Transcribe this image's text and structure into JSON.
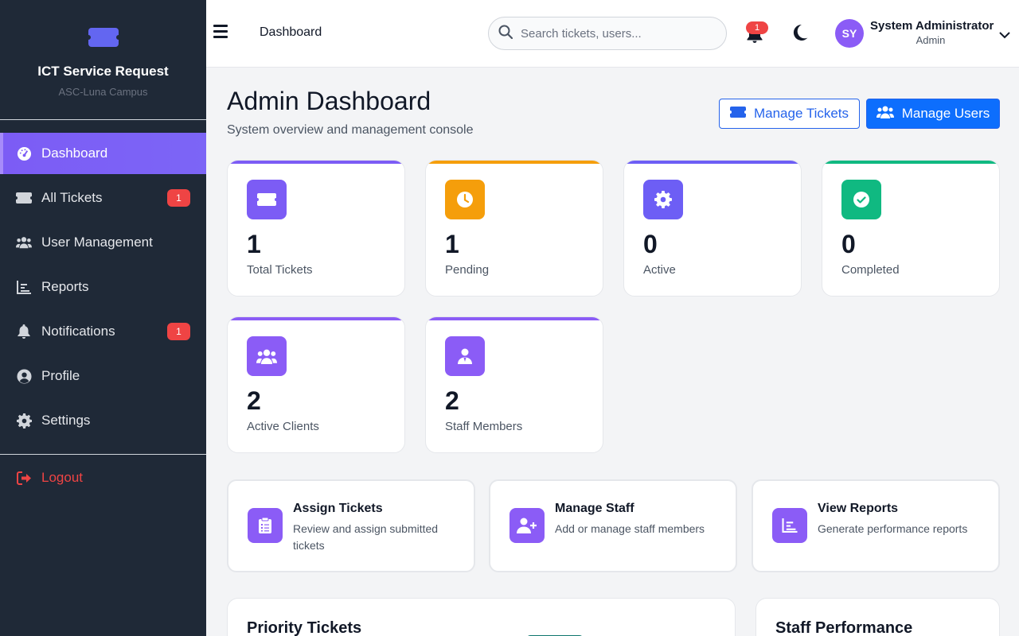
{
  "sidebar": {
    "brand_title": "ICT Service Request",
    "brand_subtitle": "ASC-Luna Campus",
    "items": [
      {
        "label": "Dashboard",
        "icon": "gauge-icon",
        "active": true
      },
      {
        "label": "All Tickets",
        "icon": "ticket-icon",
        "badge": "1"
      },
      {
        "label": "User Management",
        "icon": "users-icon"
      },
      {
        "label": "Reports",
        "icon": "chart-icon"
      },
      {
        "label": "Notifications",
        "icon": "bell-icon",
        "badge": "1"
      },
      {
        "label": "Profile",
        "icon": "user-circle-icon"
      },
      {
        "label": "Settings",
        "icon": "gear-icon"
      }
    ],
    "logout_label": "Logout"
  },
  "topbar": {
    "breadcrumb": "Dashboard",
    "search_placeholder": "Search tickets, users...",
    "notification_count": "1",
    "user": {
      "initials": "SY",
      "name": "System Administrator",
      "role": "Admin"
    }
  },
  "main": {
    "title": "Admin Dashboard",
    "subtitle": "System overview and management console",
    "manage_tickets_label": "Manage Tickets",
    "manage_users_label": "Manage Users",
    "stats": [
      {
        "value": "1",
        "label": "Total Tickets",
        "color": "#7c5cf5",
        "icon": "ticket-icon"
      },
      {
        "value": "1",
        "label": "Pending",
        "color": "#f59e0b",
        "icon": "clock-icon"
      },
      {
        "value": "0",
        "label": "Active",
        "color": "#6d5ef5",
        "icon": "gear-icon"
      },
      {
        "value": "0",
        "label": "Completed",
        "color": "#10b981",
        "icon": "check-circle-icon"
      },
      {
        "value": "2",
        "label": "Active Clients",
        "color": "#8b5cf6",
        "icon": "users-icon"
      },
      {
        "value": "2",
        "label": "Staff Members",
        "color": "#8b5cf6",
        "icon": "staff-icon"
      }
    ],
    "actions": [
      {
        "title": "Assign Tickets",
        "desc": "Review and assign submitted tickets",
        "icon": "clipboard-icon"
      },
      {
        "title": "Manage Staff",
        "desc": "Add or manage staff members",
        "icon": "user-plus-icon"
      },
      {
        "title": "View Reports",
        "desc": "Generate performance reports",
        "icon": "chart-icon"
      }
    ],
    "panels": [
      {
        "title": "Priority Tickets"
      },
      {
        "title": "Staff Performance"
      }
    ]
  }
}
